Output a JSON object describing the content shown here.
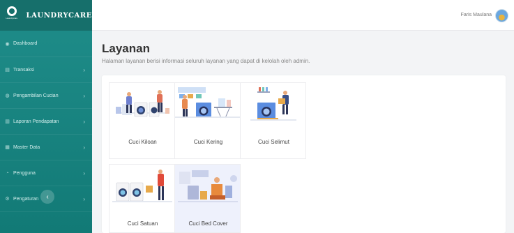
{
  "brand": {
    "name": "LAUNDRYCARE",
    "logo_caption": "Laundrycare"
  },
  "sidebar": {
    "items": [
      {
        "label": "Dashboard",
        "icon": "dashboard-icon",
        "glyph": "◉",
        "has_chevron": false
      },
      {
        "label": "Transaksi",
        "icon": "cart-icon",
        "glyph": "▤",
        "has_chevron": true
      },
      {
        "label": "Pengambilan Cucian",
        "icon": "pickup-icon",
        "glyph": "◍",
        "has_chevron": true
      },
      {
        "label": "Laporan Pendapatan",
        "icon": "report-icon",
        "glyph": "▥",
        "has_chevron": true
      },
      {
        "label": "Master Data",
        "icon": "database-icon",
        "glyph": "▦",
        "has_chevron": true
      },
      {
        "label": "Pengguna",
        "icon": "users-icon",
        "glyph": "◔",
        "has_chevron": true
      },
      {
        "label": "Pengaturan",
        "icon": "gear-icon",
        "glyph": "⚙",
        "has_chevron": true
      }
    ],
    "chevron": "›",
    "collapse_glyph": "‹"
  },
  "header": {
    "user_name": "Faris Maulana"
  },
  "page": {
    "title": "Layanan",
    "description": "Halaman layanan berisi informasi seluruh layanan yang dapat di kelolah oleh admin."
  },
  "services": [
    {
      "label": "Cuci Kiloan"
    },
    {
      "label": "Cuci Kering"
    },
    {
      "label": "Cuci Selimut"
    },
    {
      "label": "Cuci Satuan"
    },
    {
      "label": "Cuci Bed Cover"
    }
  ],
  "colors": {
    "sidebar": "#1f8d8a",
    "sidebar_dark": "#166f6b",
    "accent_active_card": "#eef1fc"
  }
}
